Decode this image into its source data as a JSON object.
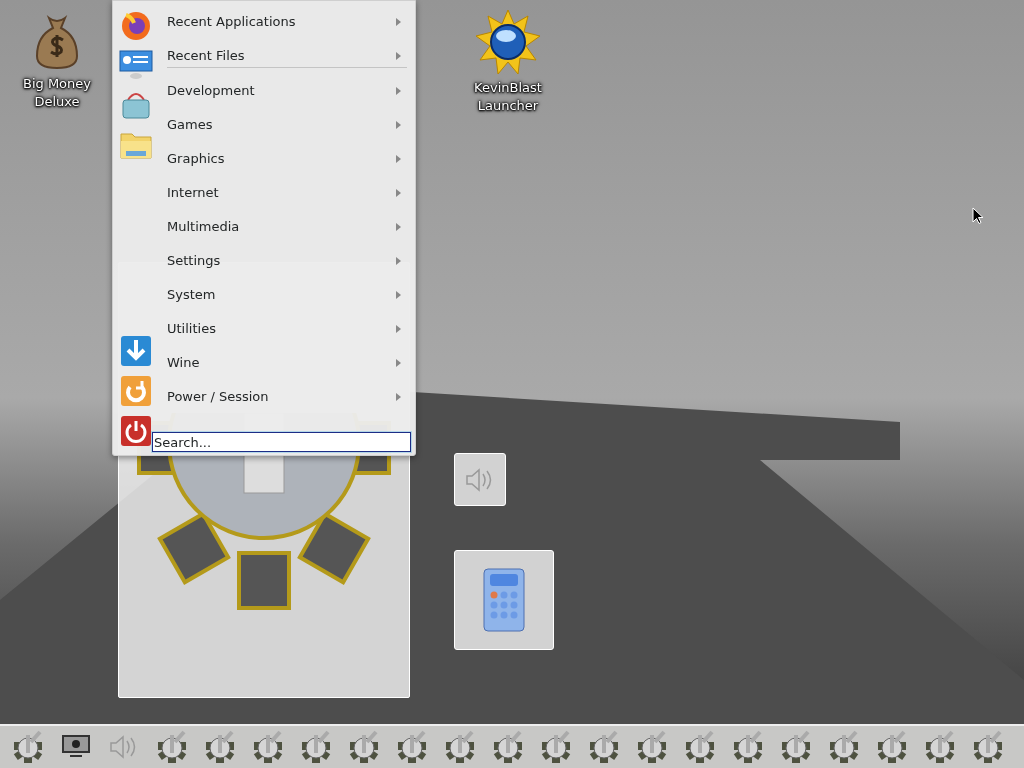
{
  "desktop_icons": [
    {
      "label": "Big Money Deluxe",
      "kind": "money-bag"
    },
    {
      "label": "KevinBlast Launcher",
      "kind": "sun-globe"
    }
  ],
  "menu": {
    "items": [
      {
        "kind": "entry",
        "label": "Recent Applications",
        "has_submenu": true
      },
      {
        "kind": "entry",
        "label": "Recent Files",
        "has_submenu": true
      },
      {
        "kind": "separator"
      },
      {
        "kind": "entry",
        "label": "Development",
        "has_submenu": true
      },
      {
        "kind": "entry",
        "label": "Games",
        "has_submenu": true
      },
      {
        "kind": "entry",
        "label": "Graphics",
        "has_submenu": true
      },
      {
        "kind": "entry",
        "label": "Internet",
        "has_submenu": true
      },
      {
        "kind": "entry",
        "label": "Multimedia",
        "has_submenu": true
      },
      {
        "kind": "entry",
        "label": "Settings",
        "has_submenu": true
      },
      {
        "kind": "entry",
        "label": "System",
        "has_submenu": true
      },
      {
        "kind": "entry",
        "label": "Utilities",
        "has_submenu": true
      },
      {
        "kind": "entry",
        "label": "Wine",
        "has_submenu": true
      },
      {
        "kind": "entry",
        "label": "Power / Session",
        "has_submenu": true
      }
    ],
    "search": {
      "placeholder": "Search...",
      "focused": true
    }
  }
}
